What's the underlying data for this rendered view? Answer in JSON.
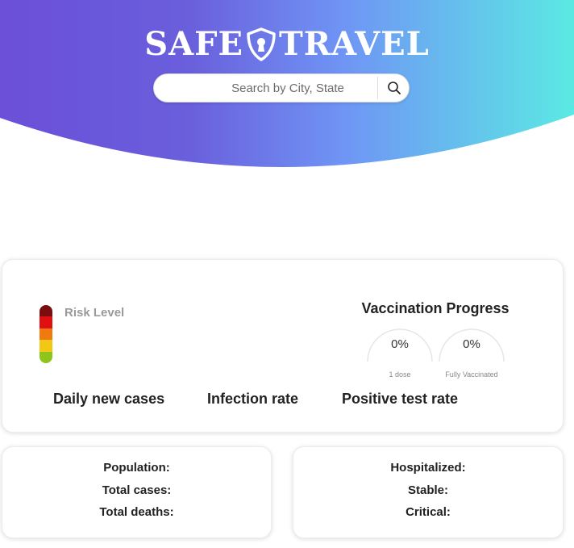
{
  "brand": {
    "part1": "SAFE",
    "part2": "TRAVEL",
    "gradient": [
      "#6b4fd8",
      "#6f8ff5",
      "#5be8e5"
    ]
  },
  "search": {
    "placeholder": "Search by City, State",
    "icon": "search-icon"
  },
  "risk": {
    "label": "Risk Level",
    "colors": [
      "#7a0d0d",
      "#e01010",
      "#f07a10",
      "#f2c817",
      "#8fc41a"
    ]
  },
  "vaccination": {
    "title": "Vaccination Progress",
    "gauges": [
      {
        "value": "0%",
        "label": "1 dose"
      },
      {
        "value": "0%",
        "label": "Fully Vaccinated"
      }
    ]
  },
  "metrics": {
    "daily_new_cases": "Daily new cases",
    "infection_rate": "Infection rate",
    "positive_test_rate": "Positive test rate"
  },
  "stats_left": {
    "population": "Population:",
    "total_cases": "Total cases:",
    "total_deaths": "Total deaths:"
  },
  "stats_right": {
    "hospitalized": "Hospitalized:",
    "stable": "Stable:",
    "critical": "Critical:"
  }
}
